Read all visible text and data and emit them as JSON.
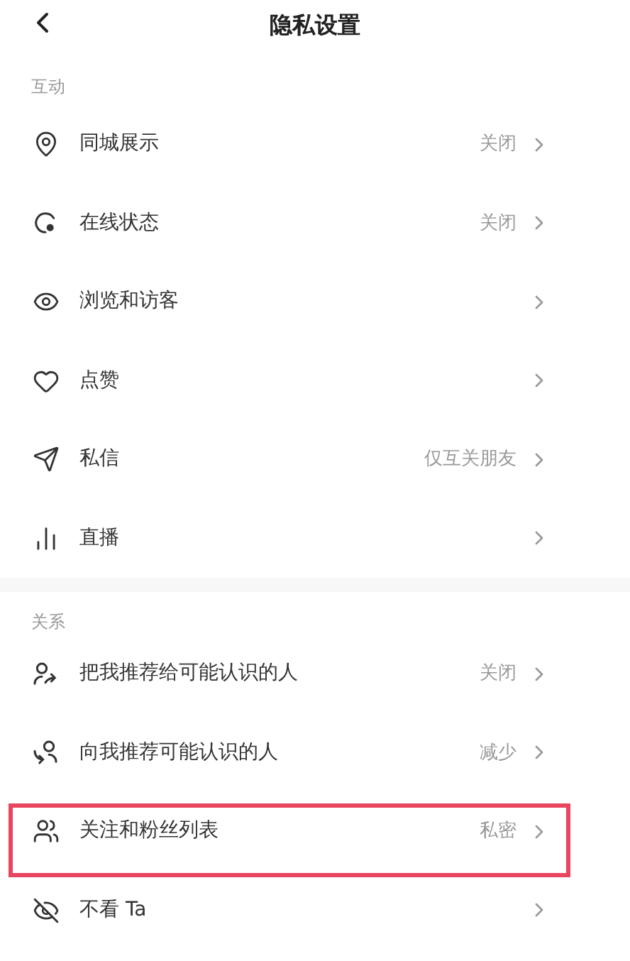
{
  "header": {
    "title": "隐私设置"
  },
  "sections": [
    {
      "title": "互动",
      "items": [
        {
          "label": "同城展示",
          "value": "关闭",
          "highlighted": false
        },
        {
          "label": "在线状态",
          "value": "关闭",
          "highlighted": false
        },
        {
          "label": "浏览和访客",
          "highlighted": false
        },
        {
          "label": "点赞",
          "highlighted": false
        },
        {
          "label": "私信",
          "value": "仅互关朋友",
          "highlighted": false
        },
        {
          "label": "直播",
          "highlighted": false
        }
      ]
    },
    {
      "title": "关系",
      "items": [
        {
          "label": "把我推荐给可能认识的人",
          "value": "关闭",
          "highlighted": false
        },
        {
          "label": "向我推荐可能认识的人",
          "value": "减少",
          "highlighted": false
        },
        {
          "label": "关注和粉丝列表",
          "value": "私密",
          "highlighted": true
        },
        {
          "label": "不看 Ta",
          "highlighted": false
        }
      ]
    }
  ]
}
